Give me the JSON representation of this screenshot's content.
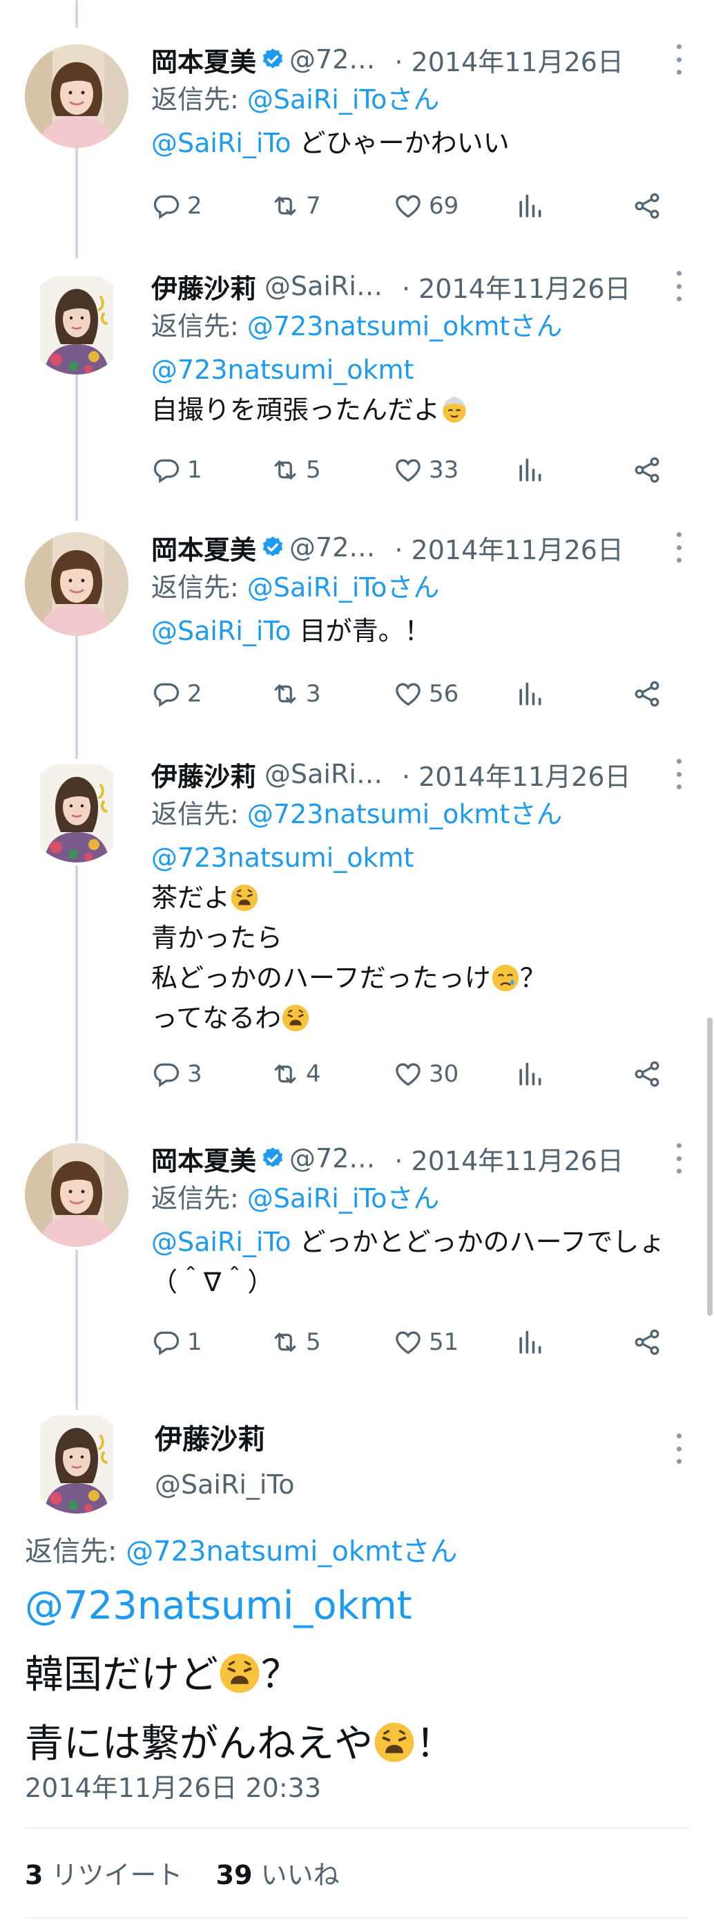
{
  "tweets": [
    {
      "name": "岡本夏美",
      "handle": "@72…",
      "verified": true,
      "date": "· 2014年11月26日",
      "reply_prefix": "返信先: ",
      "reply_to": "@SaiRi_iToさん",
      "mention": "@SaiRi_iTo",
      "text": " どひゃーかわいい",
      "replies": "2",
      "retweets": "7",
      "likes": "69"
    },
    {
      "name": "伊藤沙莉",
      "handle": "@SaiRi…",
      "verified": false,
      "date": "· 2014年11月26日",
      "reply_prefix": "返信先: ",
      "reply_to": "@723natsumi_okmtさん",
      "mention": "@723natsumi_okmt",
      "line1": "自撮りを頑張ったんだよ",
      "replies": "1",
      "retweets": "5",
      "likes": "33"
    },
    {
      "name": "岡本夏美",
      "handle": "@72…",
      "verified": true,
      "date": "· 2014年11月26日",
      "reply_prefix": "返信先: ",
      "reply_to": "@SaiRi_iToさん",
      "mention": "@SaiRi_iTo",
      "text": " 目が青。！",
      "replies": "2",
      "retweets": "3",
      "likes": "56"
    },
    {
      "name": "伊藤沙莉",
      "handle": "@SaiRi…",
      "verified": false,
      "date": "· 2014年11月26日",
      "reply_prefix": "返信先: ",
      "reply_to": "@723natsumi_okmtさん",
      "mention": "@723natsumi_okmt",
      "line1": "茶だよ",
      "line2": "青かったら",
      "line3a": "私どっかのハーフだったっけ",
      "line3b": "？",
      "line4": "ってなるわ",
      "replies": "3",
      "retweets": "4",
      "likes": "30"
    },
    {
      "name": "岡本夏美",
      "handle": "@72…",
      "verified": true,
      "date": "· 2014年11月26日",
      "reply_prefix": "返信先: ",
      "reply_to": "@SaiRi_iToさん",
      "mention": "@SaiRi_iTo",
      "text": " どっかとどっかのハーフでしょ（＾∇＾）",
      "replies": "1",
      "retweets": "5",
      "likes": "51"
    }
  ],
  "focus": {
    "name": "伊藤沙莉",
    "handle": "@SaiRi_iTo",
    "reply_prefix": "返信先: ",
    "reply_to": "@723natsumi_okmtさん",
    "mention": "@723natsumi_okmt",
    "line1": "韓国だけど",
    "line1_end": "？",
    "line2": "青には繋がんねえや",
    "line2_end": "！",
    "timestamp": "2014年11月26日 20:33",
    "retweet_count": "3",
    "retweet_label": "リツイート",
    "like_count": "39",
    "like_label": "いいね"
  },
  "icons": {
    "reply": "reply-icon",
    "retweet": "retweet-icon",
    "like": "heart-icon",
    "views": "analytics-icon",
    "share": "share-icon",
    "verified": "verified-badge-icon",
    "more": "more-icon"
  },
  "colors": {
    "link": "#1d9bf0",
    "text": "#0f1419",
    "secondary": "#536471",
    "thread_line": "#cfd9de",
    "verified": "#1d9bf0"
  }
}
